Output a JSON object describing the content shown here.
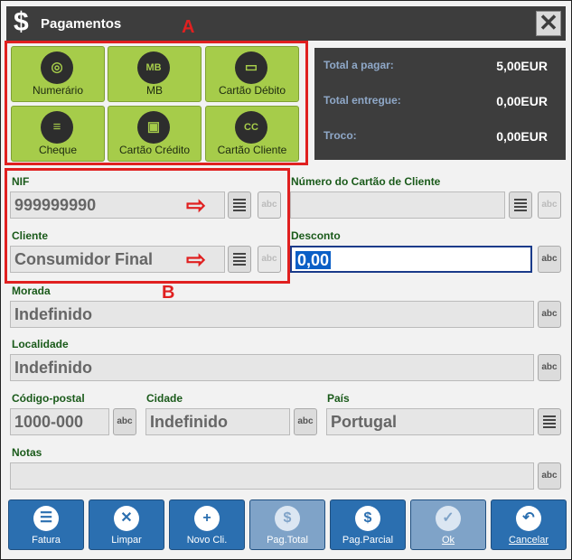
{
  "window": {
    "title": "Pagamentos",
    "title_icon": "$",
    "close_glyph": "✕"
  },
  "markers": {
    "a": "A",
    "b": "B"
  },
  "payment_methods": [
    {
      "label": "Numerário",
      "icon": "coins-icon",
      "glyph": "◎"
    },
    {
      "label": "MB",
      "icon": "mb-icon",
      "glyph": "MB"
    },
    {
      "label": "Cartão Débito",
      "icon": "card-icon",
      "glyph": "▭"
    },
    {
      "label": "Cheque",
      "icon": "cheque-icon",
      "glyph": "≡"
    },
    {
      "label": "Cartão Crédito",
      "icon": "credit-card-icon",
      "glyph": "▣"
    },
    {
      "label": "Cartão Cliente",
      "icon": "client-card-icon",
      "glyph": "CC"
    }
  ],
  "summary": {
    "total_label": "Total a pagar:",
    "total_value": "5,00EUR",
    "delivered_label": "Total entregue:",
    "delivered_value": "0,00EUR",
    "change_label": "Troco:",
    "change_value": "0,00EUR"
  },
  "form": {
    "nif_label": "NIF",
    "nif_value": "999999990",
    "card_number_label": "Número do Cartão de Cliente",
    "card_number_value": "",
    "client_label": "Cliente",
    "client_value": "Consumidor Final",
    "discount_label": "Desconto",
    "discount_value": "0,00",
    "address_label": "Morada",
    "address_value": "Indefinido",
    "locality_label": "Localidade",
    "locality_value": "Indefinido",
    "postal_label": "Código-postal",
    "postal_value": "1000-000",
    "city_label": "Cidade",
    "city_value": "Indefinido",
    "country_label": "País",
    "country_value": "Portugal",
    "notes_label": "Notas",
    "notes_value": ""
  },
  "keyboard_label": "abc",
  "arrow_glyph": "⇨",
  "actions": [
    {
      "label": "Fatura",
      "glyph": "☰",
      "enabled": true
    },
    {
      "label": "Limpar",
      "glyph": "✕",
      "enabled": true
    },
    {
      "label": "Novo Cli.",
      "glyph": "+",
      "enabled": true
    },
    {
      "label": "Pag.Total",
      "glyph": "$",
      "enabled": false
    },
    {
      "label": "Pag.Parcial",
      "glyph": "$",
      "enabled": true
    },
    {
      "label": "Ok",
      "glyph": "✓",
      "enabled": false
    },
    {
      "label": "Cancelar",
      "glyph": "↶",
      "enabled": true
    }
  ],
  "colors": {
    "accent_green": "#a6cc4a",
    "action_blue": "#2b6fb0",
    "highlight_red": "#e02020"
  }
}
